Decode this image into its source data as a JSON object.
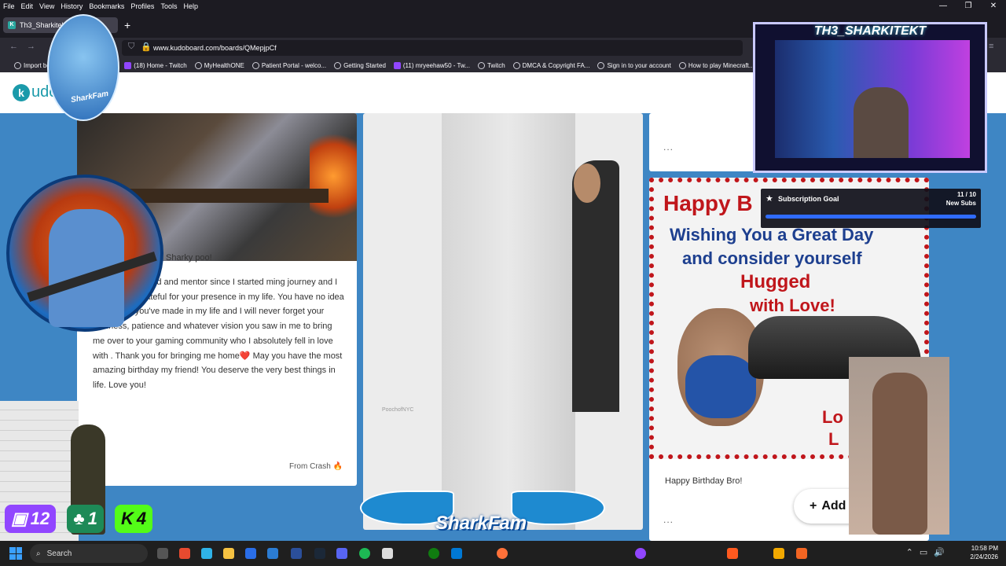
{
  "menubar": {
    "items": [
      "File",
      "Edit",
      "View",
      "History",
      "Bookmarks",
      "Profiles",
      "Tools",
      "Help"
    ]
  },
  "tab": {
    "title": "Th3_Sharkitekt",
    "favicon_letter": "K"
  },
  "url": "www.kudoboard.com/boards/QMepjpCf",
  "bookmarks": [
    "Import boo",
    "(18) Home - Twitch",
    "MyHealthONE",
    "Patient Portal - welco...",
    "Getting Started",
    "(11) mryeehaw50 - Tw...",
    "Twitch",
    "DMCA & Copyright FA...",
    "Sign in to your account",
    "How to play Minecraft..."
  ],
  "kudoboard": {
    "logo_text": "udo"
  },
  "card1": {
    "greeting": "Sharky poo!",
    "message": "an amazing friend and mentor since I started ming journey and I am ever so grateful for your presence in my life. You have no idea the impact you've made in my life and I will never forget your kindness, patience and whatever vision you saw in me to bring me over to your gaming community who I absolutely fell in love with . Thank you for bringing me home❤️ May you have the most amazing birthday my friend! You deserve the very best things in life. Love you!",
    "from": "From Crash 🔥"
  },
  "card2": {
    "watermark": "PoochofNYC"
  },
  "card3": {
    "dots": "...",
    "image_lines": [
      "Happy B",
      "Wishing You a Great Day",
      "and consider yourself",
      "Hugged",
      "with Love!",
      "Lo",
      "L"
    ],
    "caption": "Happy Birthday Bro!",
    "bottom_dots": "..."
  },
  "add_button": {
    "icon": "+",
    "label": "Add"
  },
  "stream": {
    "cam_title": "TH3_SHARKITEKT",
    "top_logo_text": "SharkFam",
    "subscription_goal": {
      "label": "Subscription Goal",
      "count": "11 / 10",
      "unit": "New Subs",
      "progress": 1.0
    },
    "counters": [
      {
        "platform": "twitch",
        "value": "12"
      },
      {
        "platform": "sharks",
        "value": "1"
      },
      {
        "platform": "kick",
        "value": "4"
      }
    ],
    "sharkfam_banner": "SharkFam"
  },
  "taskbar": {
    "search_placeholder": "Search",
    "time": "10:58 PM",
    "date": "2/24/2026",
    "notification_count": "4"
  },
  "colors": {
    "accent": "#1b9aaa",
    "board_bg": "#3e86c4",
    "twitch": "#9146ff",
    "kick": "#53fc18",
    "sub_bar": "#2f6bff"
  }
}
